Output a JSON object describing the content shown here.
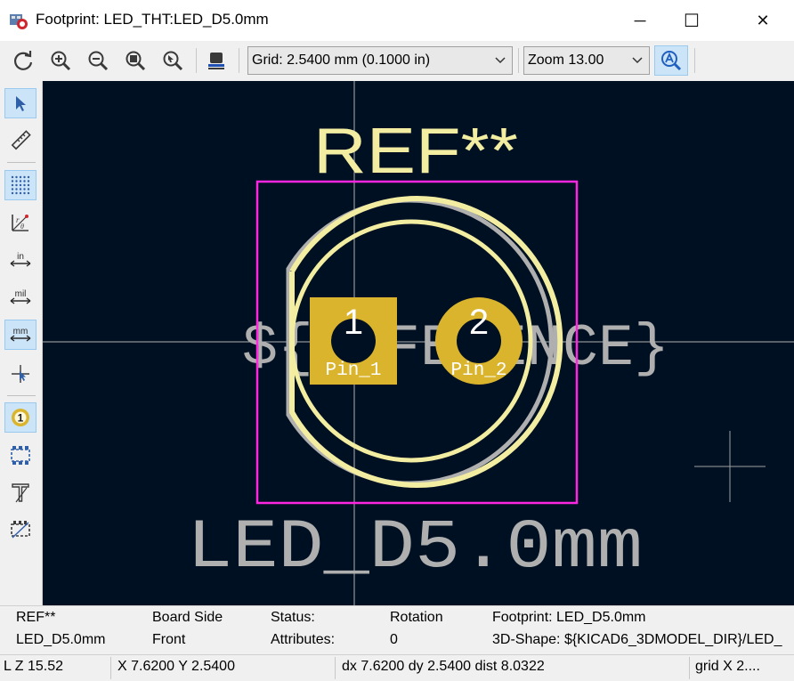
{
  "window": {
    "title": "Footprint: LED_THT:LED_D5.0mm",
    "minimize_glyph": "─",
    "maximize_glyph": "☐",
    "close_glyph": "✕"
  },
  "toolbar": {
    "grid_select": "Grid: 2.5400 mm (0.1000 in)",
    "zoom_select": "Zoom 13.00",
    "icons": [
      "refresh-icon",
      "zoom-in-icon",
      "zoom-out-icon",
      "zoom-fit-icon",
      "zoom-to-selection-icon",
      "board-side-icon",
      "auto-zoom-icon"
    ]
  },
  "left_toolbar": {
    "icons": [
      "select-arrow-icon",
      "measure-ruler-icon",
      "grid-dots-icon",
      "polar-coords-icon",
      "inches-icon",
      "mils-icon",
      "millimeters-icon",
      "full-crosshair-icon",
      "pad-number-icon",
      "pad-outline-icon",
      "text-outline-icon",
      "graphic-outline-icon"
    ],
    "in_label": "in",
    "mil_label": "mil",
    "mm_label": "mm",
    "pad_number_label": "1"
  },
  "canvas": {
    "ref_text": "REF**",
    "reference_field": "${REFERENCE}",
    "value_text": "LED_D5.0mm",
    "pads": [
      {
        "number": "1",
        "name": "Pin_1"
      },
      {
        "number": "2",
        "name": "Pin_2"
      }
    ],
    "colors": {
      "background": "#001023",
      "silkscreen": "#f2eda1",
      "fab": "#afafaf",
      "courtyard": "#ff26e2",
      "pad": "#dbb42e",
      "axis": "#b0b0b0"
    }
  },
  "message_panel": {
    "ref": "REF**",
    "value": "LED_D5.0mm",
    "board_side_label": "Board Side",
    "board_side_value": "Front",
    "status_label": "Status:",
    "attributes_label": "Attributes:",
    "rotation_label": "Rotation",
    "rotation_value": "0",
    "footprint": "Footprint: LED_D5.0mm",
    "shape3d": "3D-Shape: ${KICAD6_3DMODEL_DIR}/LED_"
  },
  "status_bar": {
    "zoom": "L Z 15.52",
    "xy": "X 7.6200  Y 2.5400",
    "delta": "dx 7.6200  dy 2.5400  dist 8.0322",
    "grid": "grid X 2...."
  }
}
